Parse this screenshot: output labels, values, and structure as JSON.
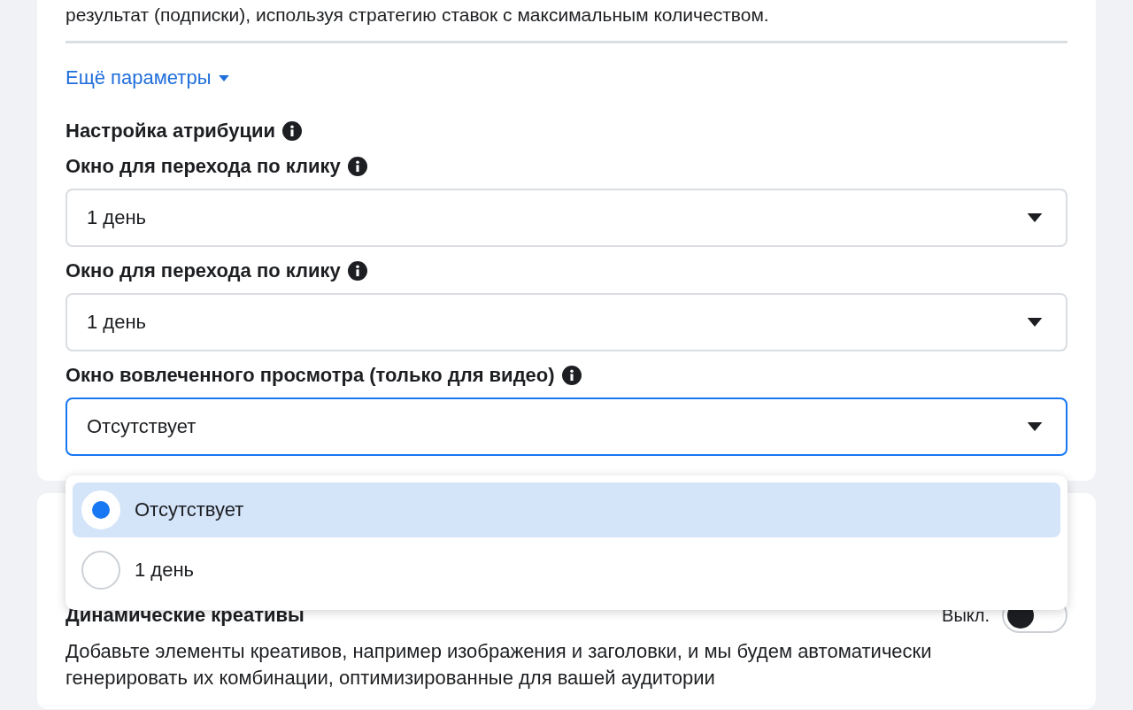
{
  "intro_text": "результат (подписки), используя стратегию ставок с максимальным количеством.",
  "more_link": {
    "label": "Ещё параметры"
  },
  "attribution": {
    "title": "Настройка атрибуции",
    "fields": [
      {
        "label": "Окно для перехода по клику",
        "value": "1 день",
        "focused": false
      },
      {
        "label": "Окно для перехода по клику",
        "value": "1 день",
        "focused": false
      },
      {
        "label": "Окно вовлеченного просмотра (только для видео)",
        "value": "Отсутствует",
        "focused": true
      }
    ]
  },
  "dropdown": {
    "options": [
      {
        "label": "Отсутствует",
        "selected": true
      },
      {
        "label": "1 день",
        "selected": false
      }
    ]
  },
  "dynamic_creatives": {
    "title": "Динамические креативы",
    "toggle_label": "Выкл.",
    "on": false,
    "description": "Добавьте элементы креативов, например изображения и заголовки, и мы будем автоматически генерировать их комбинации, оптимизированные для вашей аудитории"
  }
}
